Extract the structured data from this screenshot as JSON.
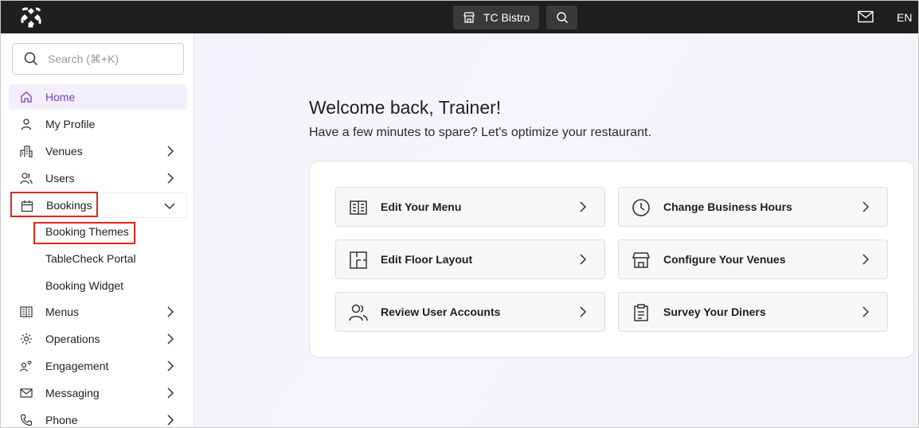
{
  "topbar": {
    "venue_name": "TC Bistro",
    "language": "EN"
  },
  "sidebar": {
    "search_placeholder": "Search (⌘+K)",
    "items": [
      {
        "label": "Home",
        "icon": "home-icon",
        "active": true
      },
      {
        "label": "My Profile",
        "icon": "person-icon"
      },
      {
        "label": "Venues",
        "icon": "building-icon",
        "has_children": true
      },
      {
        "label": "Users",
        "icon": "users-icon",
        "has_children": true
      },
      {
        "label": "Bookings",
        "icon": "calendar-icon",
        "has_children": true,
        "expanded": true
      },
      {
        "label": "Menus",
        "icon": "menu-book-icon",
        "has_children": true
      },
      {
        "label": "Operations",
        "icon": "cog-operations-icon",
        "has_children": true
      },
      {
        "label": "Engagement",
        "icon": "engagement-icon",
        "has_children": true
      },
      {
        "label": "Messaging",
        "icon": "envelope-icon",
        "has_children": true
      },
      {
        "label": "Phone",
        "icon": "phone-icon",
        "has_children": true
      }
    ],
    "bookings_subitems": [
      {
        "label": "Booking Themes"
      },
      {
        "label": "TableCheck Portal"
      },
      {
        "label": "Booking Widget"
      }
    ]
  },
  "main": {
    "welcome": "Welcome back, Trainer!",
    "subtitle": "Have a few minutes to spare? Let's optimize your restaurant.",
    "actions": [
      {
        "label": "Edit Your Menu",
        "icon": "menu-book-icon"
      },
      {
        "label": "Change Business Hours",
        "icon": "clock-icon"
      },
      {
        "label": "Edit Floor Layout",
        "icon": "floor-layout-icon"
      },
      {
        "label": "Configure Your Venues",
        "icon": "storefront-icon"
      },
      {
        "label": "Review User Accounts",
        "icon": "users-icon"
      },
      {
        "label": "Survey Your Diners",
        "icon": "clipboard-icon"
      }
    ]
  },
  "colors": {
    "topbar_bg": "#1f1f1f",
    "active_accent": "#7a3fc1",
    "highlight_box": "#e0271a"
  }
}
